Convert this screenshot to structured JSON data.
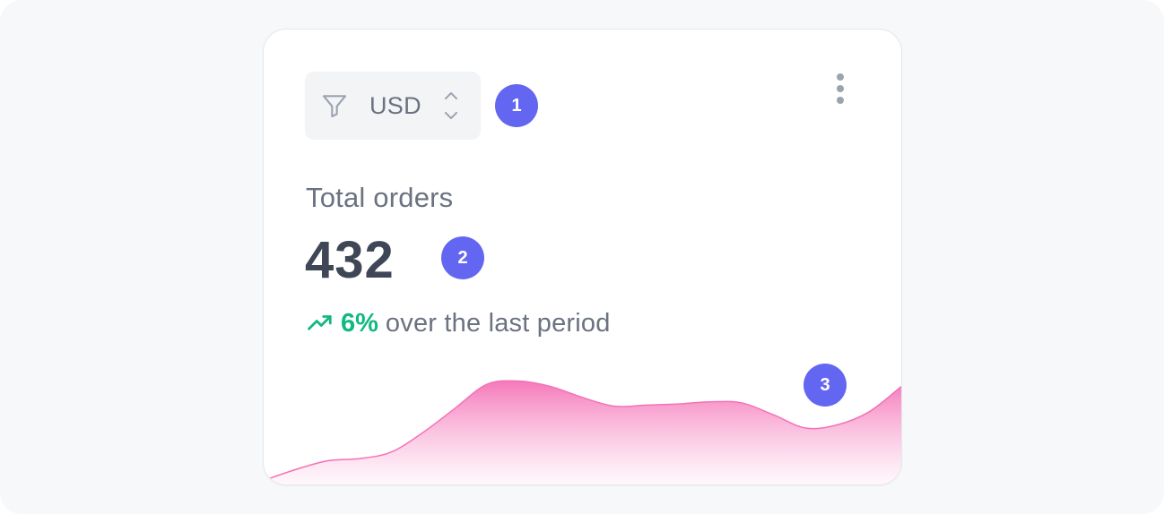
{
  "currency": {
    "value": "USD",
    "icon": "filter-icon",
    "toggle_icon": "chevron-up-down-icon"
  },
  "markers": [
    "1",
    "2",
    "3"
  ],
  "metric": {
    "label": "Total orders",
    "value": "432"
  },
  "trend": {
    "direction": "up",
    "percent": "6%",
    "text": "over the last period",
    "icon": "trending-up-icon",
    "color": "#10b981"
  },
  "menu": {
    "icon": "more-vertical-icon"
  },
  "colors": {
    "badge": "#6366f1",
    "sparkline": "#f472b6"
  },
  "chart_data": {
    "type": "area",
    "series": [
      {
        "values": [
          2,
          12,
          20,
          22,
          28,
          46,
          68,
          90,
          93,
          88,
          78,
          70,
          71,
          72,
          74,
          73,
          62,
          50,
          53,
          65,
          88
        ]
      }
    ],
    "ylim": [
      0,
      100
    ],
    "grid": false,
    "legend": "none",
    "title": "",
    "xlabel": "",
    "ylabel": ""
  }
}
